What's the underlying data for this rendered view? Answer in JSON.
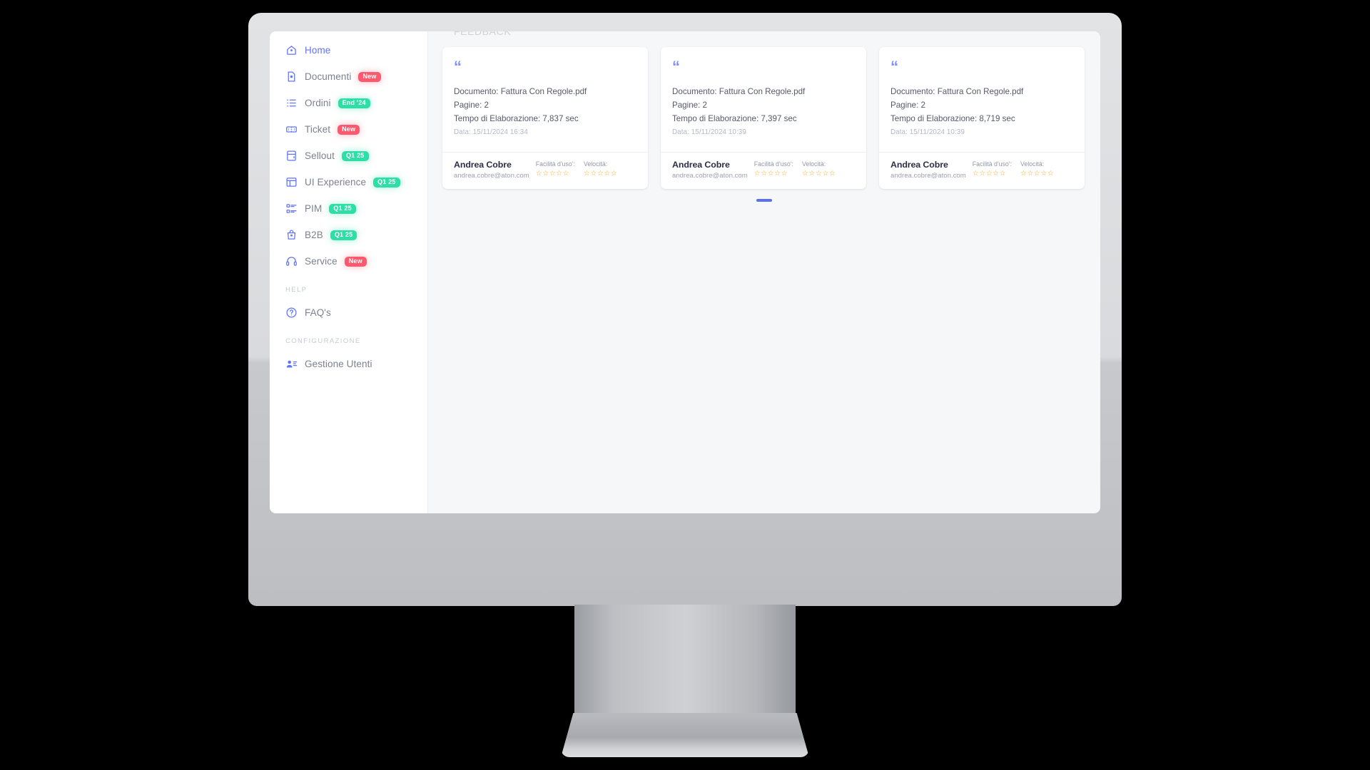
{
  "page": {
    "title": "FEEDBACK"
  },
  "sidebar": {
    "items": [
      {
        "label": "Home",
        "icon": "home-icon",
        "badge": null,
        "badge_color": null,
        "active": true
      },
      {
        "label": "Documenti",
        "icon": "document-icon",
        "badge": "New",
        "badge_color": "#fb5a6e",
        "active": false
      },
      {
        "label": "Ordini",
        "icon": "list-icon",
        "badge": "End '24",
        "badge_color": "#2ddfa4",
        "active": false
      },
      {
        "label": "Ticket",
        "icon": "ticket-icon",
        "badge": "New",
        "badge_color": "#fb5a6e",
        "active": false
      },
      {
        "label": "Sellout",
        "icon": "calculator-icon",
        "badge": "Q1 25",
        "badge_color": "#2ddfa4",
        "active": false
      },
      {
        "label": "UI Experience",
        "icon": "layout-icon",
        "badge": "Q1 25",
        "badge_color": "#2ddfa4",
        "active": false
      },
      {
        "label": "PIM",
        "icon": "attributes-icon",
        "badge": "Q1 25",
        "badge_color": "#2ddfa4",
        "active": false
      },
      {
        "label": "B2B",
        "icon": "bag-icon",
        "badge": "Q1 25",
        "badge_color": "#2ddfa4",
        "active": false
      },
      {
        "label": "Service",
        "icon": "headset-icon",
        "badge": "New",
        "badge_color": "#fb5a6e",
        "active": false
      }
    ],
    "sections": [
      {
        "title": "HELP",
        "items": [
          {
            "label": "FAQ's",
            "icon": "help-circle-icon"
          }
        ]
      },
      {
        "title": "CONFIGURAZIONE",
        "items": [
          {
            "label": "Gestione Utenti",
            "icon": "user-settings-icon"
          }
        ]
      }
    ]
  },
  "feedback_cards": [
    {
      "quote_icon": "quote-icon",
      "document_line": "Documento: Fattura Con Regole.pdf",
      "pages_line": "Pagine: 2",
      "time_line": "Tempo di Elaborazione: 7,837 sec",
      "date_line": "Data: 15/11/2024 16:34",
      "author_name": "Andrea Cobre",
      "author_email": "andrea.cobre@aton.com",
      "rating_labels": [
        "Facilità d'uso':",
        "Velocità:"
      ],
      "rating_values": [
        0,
        0
      ],
      "rating_max": 5
    },
    {
      "quote_icon": "quote-icon",
      "document_line": "Documento: Fattura Con Regole.pdf",
      "pages_line": "Pagine: 2",
      "time_line": "Tempo di Elaborazione: 7,397 sec",
      "date_line": "Data: 15/11/2024 10:39",
      "author_name": "Andrea Cobre",
      "author_email": "andrea.cobre@aton.com",
      "rating_labels": [
        "Facilità d'uso':",
        "Velocità:"
      ],
      "rating_values": [
        0,
        0
      ],
      "rating_max": 5
    },
    {
      "quote_icon": "quote-icon",
      "document_line": "Documento: Fattura Con Regole.pdf",
      "pages_line": "Pagine: 2",
      "time_line": "Tempo di Elaborazione: 8,719 sec",
      "date_line": "Data: 15/11/2024 10:39",
      "author_name": "Andrea Cobre",
      "author_email": "andrea.cobre@aton.com",
      "rating_labels": [
        "Facilità d'uso':",
        "Velocità:"
      ],
      "rating_values": [
        0,
        0
      ],
      "rating_max": 5
    }
  ],
  "carousel": {
    "total": 1,
    "active": 0
  },
  "colors": {
    "accent": "#6274f5",
    "badge_new": "#fb5a6e",
    "badge_quarter": "#2ddfa4",
    "star": "#f5a623",
    "content_bg": "#f6f7f9",
    "sidebar_bg": "#ffffff"
  }
}
